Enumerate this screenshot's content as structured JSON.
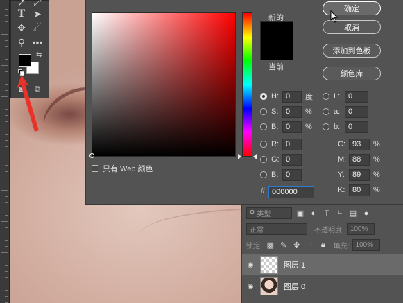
{
  "dialog": {
    "new_label": "新的",
    "current_label": "当前",
    "buttons": {
      "ok": "确定",
      "cancel": "取消",
      "add_swatch": "添加到色板",
      "color_libraries": "颜色库"
    },
    "web_only_label": "只有 Web 颜色",
    "hsb": [
      {
        "key": "H:",
        "value": "0",
        "unit": "度",
        "selected": true
      },
      {
        "key": "S:",
        "value": "0",
        "unit": "%",
        "selected": false
      },
      {
        "key": "B:",
        "value": "0",
        "unit": "%",
        "selected": false
      }
    ],
    "rgb": [
      {
        "key": "R:",
        "value": "0"
      },
      {
        "key": "G:",
        "value": "0"
      },
      {
        "key": "B:",
        "value": "0"
      }
    ],
    "lab": [
      {
        "key": "L:",
        "value": "0"
      },
      {
        "key": "a:",
        "value": "0"
      },
      {
        "key": "b:",
        "value": "0"
      }
    ],
    "cmyk": [
      {
        "key": "C:",
        "value": "93",
        "unit": "%"
      },
      {
        "key": "M:",
        "value": "88",
        "unit": "%"
      },
      {
        "key": "Y:",
        "value": "89",
        "unit": "%"
      },
      {
        "key": "K:",
        "value": "80",
        "unit": "%"
      }
    ],
    "hex_prefix": "#",
    "hex_value": "000000",
    "new_color": "#000000",
    "current_color": "#000000"
  },
  "toolbar": {
    "foreground": "#000000",
    "background": "#ffffff",
    "icons": [
      "move-icon",
      "type-icon",
      "direct-select-icon",
      "puzzle-icon",
      "blur-icon",
      "zoom-icon",
      "more-icon",
      "quick-mask-icon",
      "screen-mode-icon"
    ]
  },
  "layers_panel": {
    "filter_kind": "类型",
    "blend_mode": "正常",
    "opacity_label": "不透明度:",
    "opacity_value": "100%",
    "lock_label": "锁定:",
    "fill_label": "填充:",
    "fill_value": "100%",
    "layers": [
      {
        "name": "图层 1",
        "selected": true
      },
      {
        "name": "图层 0",
        "selected": false
      }
    ]
  },
  "accent_colors": {
    "arrow": "#e8322a",
    "hex_focus": "#2f7bd1"
  }
}
